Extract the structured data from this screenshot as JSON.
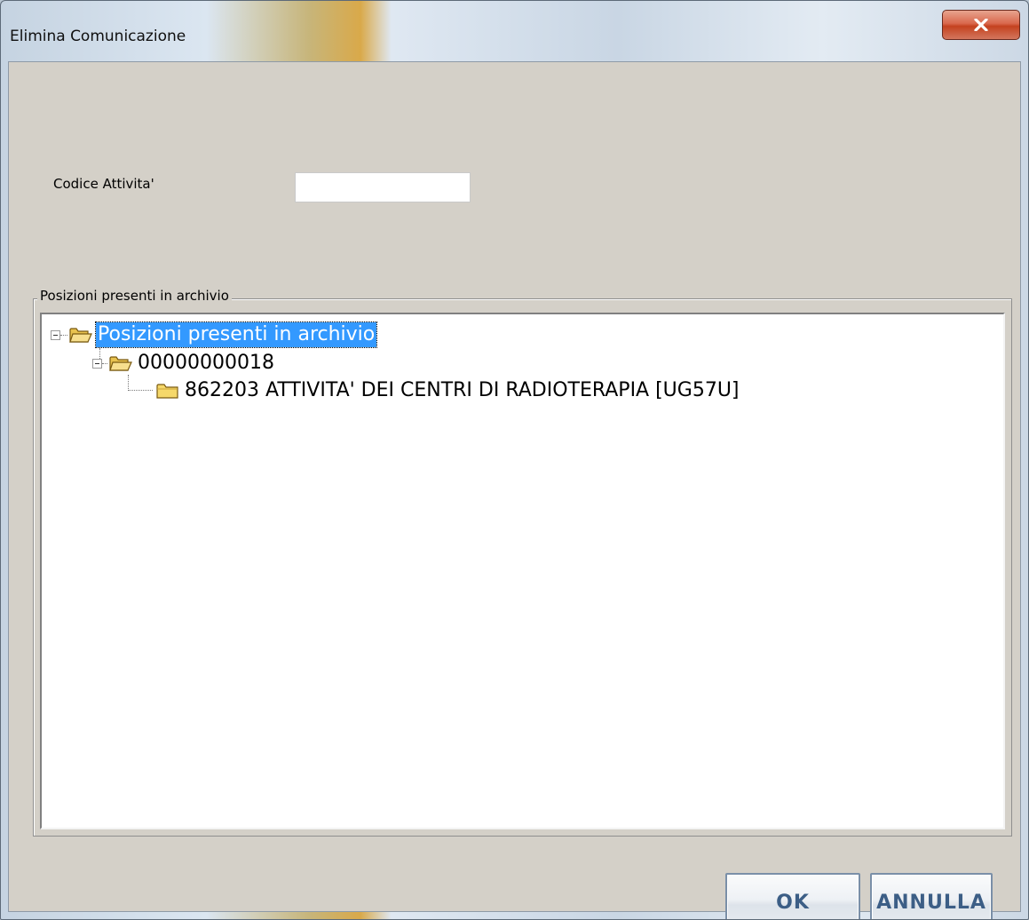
{
  "window": {
    "title": "Elimina Comunicazione",
    "close_label": "x"
  },
  "form": {
    "codice_label": "Codice Attivita'",
    "codice_value": "",
    "codice_placeholder": ""
  },
  "group": {
    "legend": "Posizioni presenti in archivio"
  },
  "tree": {
    "root": "Posizioni presenti in archivio",
    "child": "00000000018",
    "grandchild": "862203 ATTIVITA' DEI CENTRI DI RADIOTERAPIA [UG57U]"
  },
  "buttons": {
    "ok": "OK",
    "cancel": "ANNULLA"
  },
  "colors": {
    "selection": "#3399ff",
    "dialog_bg": "#d4d0c8",
    "close_button": "#c4421f",
    "button_text": "#3c5e86",
    "folder": "#f2d36b"
  },
  "icons": {
    "close": "close-icon",
    "folder_open": "folder-open-icon",
    "folder_closed": "folder-icon",
    "collapse": "collapse-icon"
  }
}
